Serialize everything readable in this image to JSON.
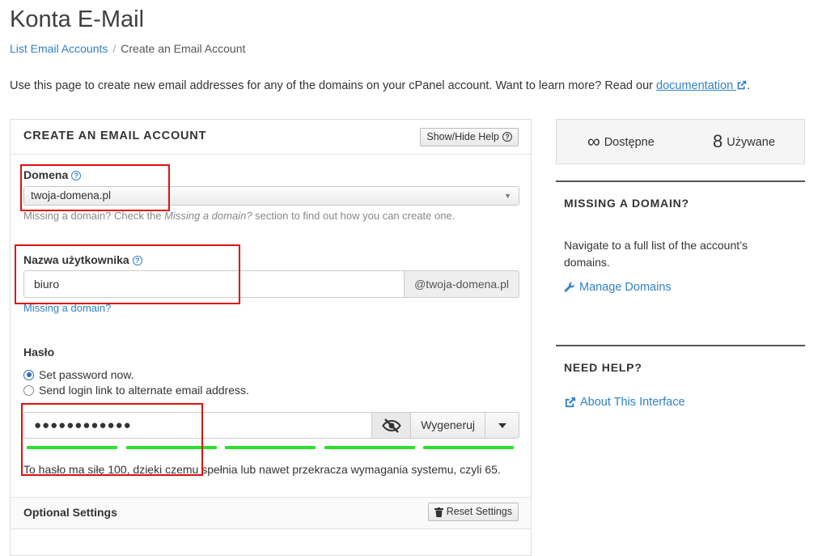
{
  "page": {
    "title": "Konta E-Mail",
    "breadcrumb": {
      "parent": "List Email Accounts",
      "separator": "/",
      "current": "Create an Email Account"
    },
    "intro_text": "Use this page to create new email addresses for any of the domains on your cPanel account. Want to learn more? Read our ",
    "intro_link": "documentation",
    "intro_end": "."
  },
  "form": {
    "title": "CREATE AN EMAIL ACCOUNT",
    "help_button": "Show/Hide Help",
    "domain": {
      "label": "Domena",
      "value": "twoja-domena.pl",
      "hint_pre": "Missing a domain? Check the ",
      "hint_em": "Missing a domain?",
      "hint_post": " section to find out how you can create one."
    },
    "username": {
      "label": "Nazwa użytkownika",
      "value": "biuro",
      "suffix": "@twoja-domena.pl",
      "missing_link": "Missing a domain?"
    },
    "password": {
      "label": "Hasło",
      "option_set": "Set password now.",
      "option_link": "Send login link to alternate email address.",
      "value": "●●●●●●●●●●●●",
      "generate_button": "Wygeneruj",
      "strength_percent": 100,
      "strength_text": "To hasło ma siłę 100, dzięki czemu spełnia lub nawet przekracza wymagania systemu, czyli 65."
    },
    "optional": {
      "title": "Optional Settings",
      "reset_button": "Reset Settings"
    }
  },
  "stats": {
    "available_value": "∞",
    "available_label": "Dostępne",
    "used_value": "8",
    "used_label": "Używane"
  },
  "sidebar": {
    "missing": {
      "title": "MISSING A DOMAIN?",
      "text": "Navigate to a full list of the account’s domains.",
      "link": "Manage Domains"
    },
    "help": {
      "title": "NEED HELP?",
      "link": "About This Interface"
    }
  },
  "colors": {
    "link": "#2f82c4",
    "strength": "#2ee02e",
    "annotation": "#e01010"
  }
}
